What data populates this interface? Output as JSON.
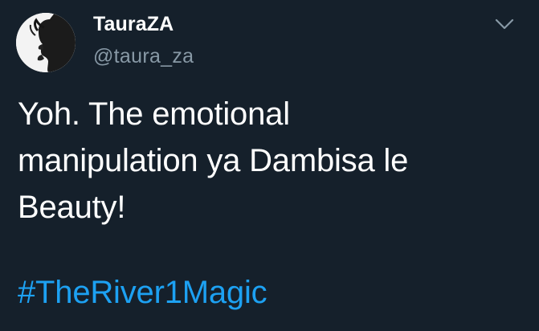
{
  "tweet": {
    "author": {
      "display_name": "TauraZA",
      "handle": "@taura_za",
      "avatar_icon": "profile-avatar-silhouette"
    },
    "menu_icon": "chevron-down-icon",
    "text": "Yoh. The emotional\nmanipulation ya Dambisa le\nBeauty!",
    "hashtag": "#TheRiver1Magic"
  },
  "colors": {
    "background": "#15202b",
    "primary_text": "#ffffff",
    "secondary_text": "#8899a6",
    "link": "#1da1f2"
  }
}
